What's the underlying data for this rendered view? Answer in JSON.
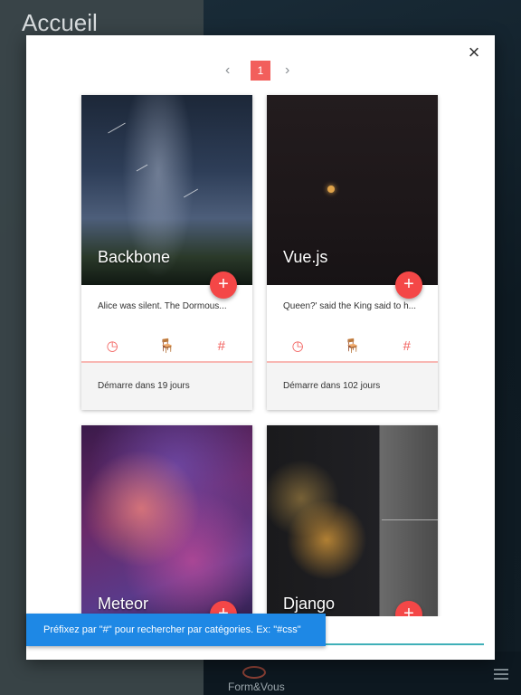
{
  "app": {
    "sidebar_title": "Accueil",
    "brand": "Form&Vous"
  },
  "modal": {
    "close_glyph": "×",
    "pagination": {
      "prev_glyph": "‹",
      "next_glyph": "›",
      "current_page": "1"
    }
  },
  "cards": [
    {
      "name": "Backbone",
      "description": "Alice was silent. The Dormous...",
      "footer": "Démarre dans 19 jours",
      "add_glyph": "+",
      "icons": [
        "clock-icon",
        "seat-icon",
        "hash-icon"
      ]
    },
    {
      "name": "Vue.js",
      "description": "Queen?' said the King said to h...",
      "footer": "Démarre dans 102 jours",
      "add_glyph": "+",
      "icons": [
        "clock-icon",
        "seat-icon",
        "hash-icon"
      ]
    },
    {
      "name": "Meteor",
      "add_glyph": "+"
    },
    {
      "name": "Django",
      "add_glyph": "+"
    }
  ],
  "action_glyphs": {
    "clock": "◷",
    "seat": "🪑",
    "hash": "#"
  },
  "snackbar": {
    "text": "Préfixez par \"#\" pour rechercher par catégories. Ex: \"#css\""
  },
  "colors": {
    "accent": "#f25f5c",
    "fab": "#f44747",
    "snackbar": "#1e88e5",
    "input_underline": "#3fb0b8"
  }
}
